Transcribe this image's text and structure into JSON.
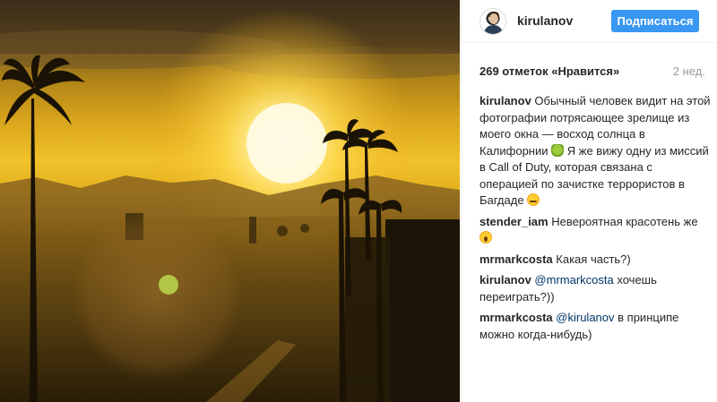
{
  "post": {
    "author": "kirulanov",
    "follow_label": "Подписаться",
    "likes": "269 отметок «Нравится»",
    "age": "2 нед.",
    "caption": {
      "author": "kirulanov",
      "text_part1": "Обычный человек видит на этой фотографии потрясающее зрелище из моего окна — восход солнца в Калифорнии",
      "emoji1": "sick-face-emoji",
      "text_part2": "Я же вижу одну из миссий в Call of Duty, которая связана с операцией по зачистке террористов в Багдаде",
      "emoji2": "persevering-face-emoji"
    },
    "comments": [
      {
        "author": "stender_iam",
        "text": "Невероятная красотень же",
        "emoji": "screaming-face-emoji"
      },
      {
        "author": "mrmarkcosta",
        "text": "Какая часть?)"
      },
      {
        "author": "kirulanov",
        "mention": "@mrmarkcosta",
        "text": "хочешь переиграть?))"
      },
      {
        "author": "mrmarkcosta",
        "mention": "@kirulanov",
        "text": "в принципе можно когда-нибудь)"
      }
    ]
  },
  "colors": {
    "follow_button": "#3897f0",
    "mention": "#003569",
    "muted": "#999999"
  }
}
